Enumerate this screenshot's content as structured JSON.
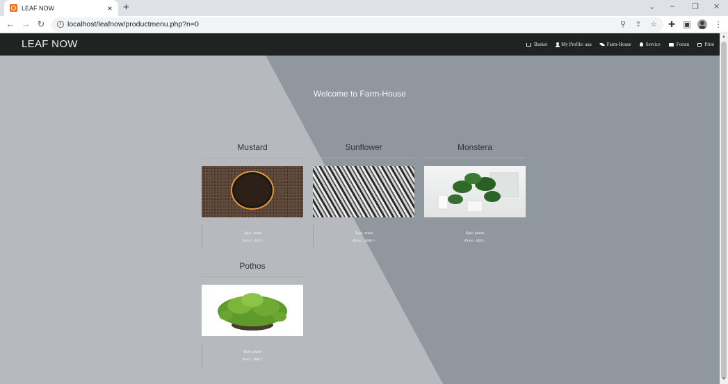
{
  "browser": {
    "tab_title": "LEAF NOW",
    "url": "localhost/leafnow/productmenu.php?n=0"
  },
  "site": {
    "brand": "LEAF NOW",
    "nav": [
      {
        "label": "Basket",
        "icon": "cart-icon"
      },
      {
        "label": "My Profile: aaa",
        "icon": "user-icon"
      },
      {
        "label": "Farm-House",
        "icon": "leaf-icon"
      },
      {
        "label": "Service",
        "icon": "drop-icon"
      },
      {
        "label": "Forum",
        "icon": "comment-icon"
      },
      {
        "label": "Print",
        "icon": "print-icon"
      }
    ],
    "welcome": "Welcome to Farm-House"
  },
  "products": [
    {
      "name": "Mustard",
      "type": "Type: seeds",
      "price": "Price : 250 /-"
    },
    {
      "name": "Sunflower",
      "type": "Type: seeds",
      "price": "Price : 1200 /-"
    },
    {
      "name": "Monstera",
      "type": "Type: plants",
      "price": "Price : 650 /-"
    },
    {
      "name": "Pothos",
      "type": "Type: plants",
      "price": "Price : 800 /-"
    }
  ]
}
